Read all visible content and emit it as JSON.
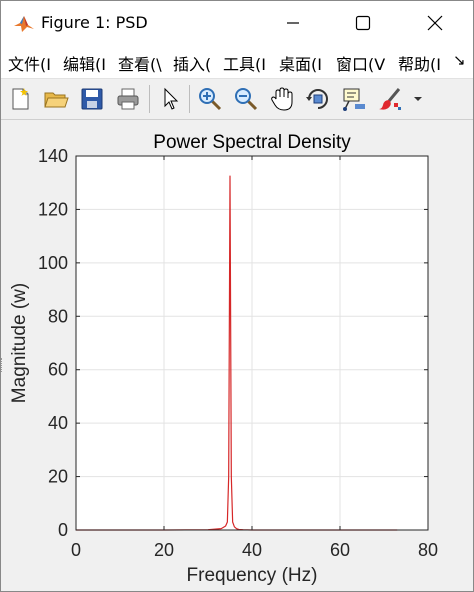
{
  "window": {
    "title": "Figure 1: PSD",
    "icon": "matlab-logo-icon"
  },
  "menu": {
    "items": [
      "文件(I",
      "编辑(I",
      "查看(\\",
      "插入(",
      "工具(I",
      "桌面(I",
      "窗口(V",
      "帮助(I"
    ],
    "overflow_label": "↘"
  },
  "toolbar": {
    "buttons": [
      "new-figure-icon",
      "open-file-icon",
      "save-icon",
      "print-icon",
      "select-arrow-icon",
      "zoom-in-icon",
      "zoom-out-icon",
      "pan-hand-icon",
      "rotate-3d-icon",
      "data-cursor-icon",
      "brush-icon",
      "dropdown-arrow-icon"
    ]
  },
  "chart_data": {
    "type": "line",
    "title": "Power Spectral Density",
    "xlabel": "Frequency (Hz)",
    "ylabel": "Magnitude (w)",
    "xlim": [
      0,
      80
    ],
    "ylim": [
      0,
      140
    ],
    "xticks": [
      0,
      20,
      40,
      60,
      80
    ],
    "yticks": [
      0,
      20,
      40,
      60,
      80,
      100,
      120,
      140
    ],
    "grid": true,
    "series": [
      {
        "color": "#d62728",
        "x": [
          0,
          10,
          20,
          30,
          33,
          33.5,
          34,
          34.4,
          34.7,
          34.9,
          35.0,
          35.1,
          35.3,
          35.6,
          36.0,
          36.5,
          37,
          38,
          40,
          50,
          60,
          70,
          73
        ],
        "y": [
          0,
          0,
          0,
          0.1,
          0.5,
          1.0,
          1.5,
          3.0,
          20.0,
          95.0,
          132.5,
          95.0,
          20.0,
          3.0,
          1.2,
          0.5,
          0.2,
          0.1,
          0,
          0,
          0,
          0,
          0
        ]
      }
    ]
  }
}
